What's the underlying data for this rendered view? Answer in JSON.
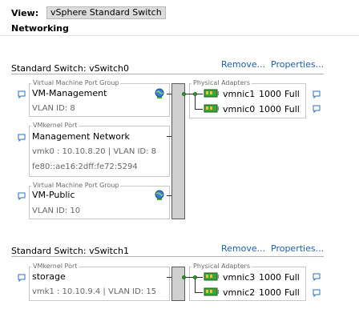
{
  "view": {
    "label": "View:",
    "value": "vSphere Standard Switch"
  },
  "section": {
    "title": "Networking"
  },
  "switches": [
    {
      "title": "Standard Switch: vSwitch0",
      "remove_label": "Remove...",
      "properties_label": "Properties...",
      "port_groups": [
        {
          "kind": "Virtual Machine Port Group",
          "name": "VM-Management",
          "details": [
            "VLAN ID: 8"
          ]
        },
        {
          "kind": "VMkernel Port",
          "name": "Management Network",
          "details": [
            "vmk0 : 10.10.8.20 | VLAN ID: 8",
            "fe80::ae16:2dff:fe72:5294"
          ]
        },
        {
          "kind": "Virtual Machine Port Group",
          "name": "VM-Public",
          "details": [
            "VLAN ID: 10"
          ]
        }
      ],
      "adapters_label": "Physical Adapters",
      "adapters": [
        {
          "name": "vmnic1",
          "speed": "1000",
          "duplex": "Full"
        },
        {
          "name": "vmnic0",
          "speed": "1000",
          "duplex": "Full"
        }
      ]
    },
    {
      "title": "Standard Switch: vSwitch1",
      "remove_label": "Remove...",
      "properties_label": "Properties...",
      "port_groups": [
        {
          "kind": "VMkernel Port",
          "name": "storage",
          "details": [
            "vmk1 : 10.10.9.4 | VLAN ID: 15"
          ]
        }
      ],
      "adapters_label": "Physical Adapters",
      "adapters": [
        {
          "name": "vmnic3",
          "speed": "1000",
          "duplex": "Full"
        },
        {
          "name": "vmnic2",
          "speed": "1000",
          "duplex": "Full"
        }
      ]
    }
  ],
  "icons": {
    "bubble": "speech-bubble-icon",
    "globe": "globe-icon",
    "nic": "network-adapter-icon"
  },
  "colors": {
    "link": "#1f5fa8",
    "bus": "#cfcfcf",
    "nic_green": "#3aa63a"
  }
}
